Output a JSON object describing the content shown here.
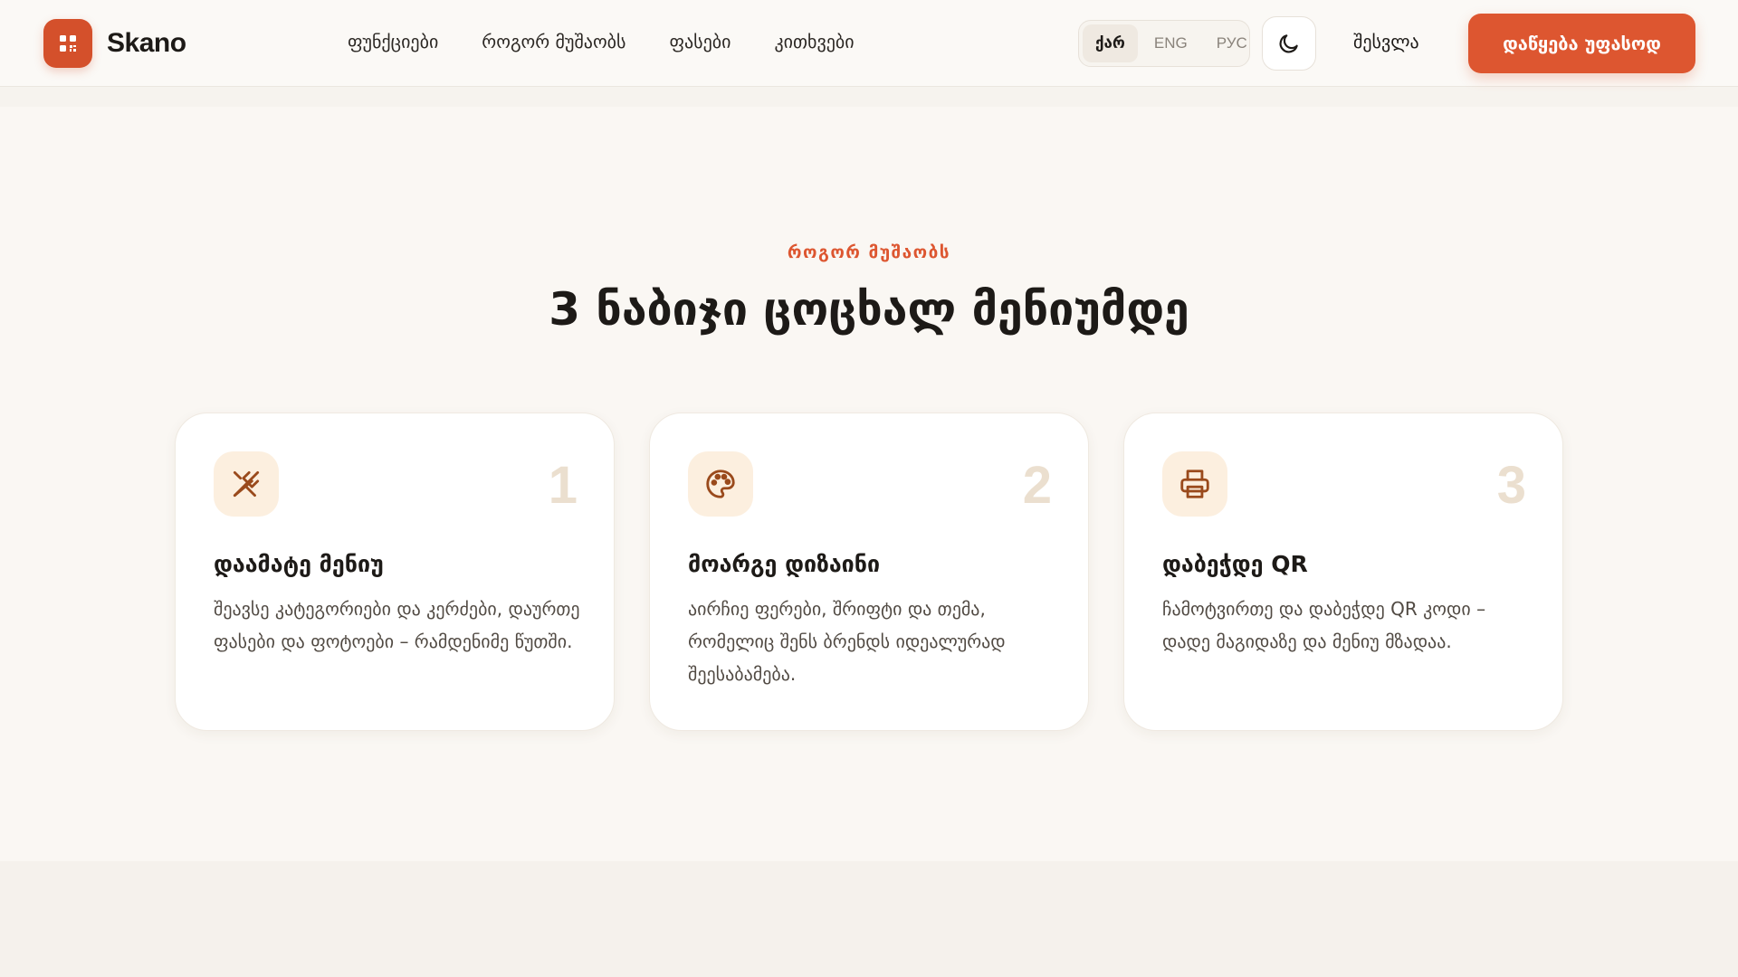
{
  "header": {
    "brand": "Skano",
    "nav": [
      "ფუნქციები",
      "როგორ მუშაობს",
      "ფასები",
      "კითხვები"
    ],
    "languages": [
      "ქარ",
      "ENG",
      "РУС"
    ],
    "active_language": "ქარ",
    "theme_icon": "moon-icon",
    "login_label": "შესვლა",
    "cta_label": "დაწყება უფასოდ"
  },
  "section": {
    "eyebrow": "როგორ მუშაობს",
    "title": "3 ნაბიჯი ცოცხალ მენიუმდე",
    "steps": [
      {
        "number": "1",
        "icon": "utensils-icon",
        "title": "დაამატე მენიუ",
        "description": "შეავსე კატეგორიები და კერძები, დაურთე ფასები და ფოტოები – რამდენიმე წუთში."
      },
      {
        "number": "2",
        "icon": "palette-icon",
        "title": "მოარგე დიზაინი",
        "description": "აირჩიე ფერები, შრიფტი და თემა, რომელიც შენს ბრენდს იდეალურად შეესაბამება."
      },
      {
        "number": "3",
        "icon": "printer-icon",
        "title": "დაბეჭდე QR",
        "description": "ჩამოტვირთე და დაბეჭდე QR კოდი – დადე მაგიდაზე და მენიუ მზადაა."
      }
    ]
  },
  "colors": {
    "accent": "#dd5630",
    "icon_bg": "#fcefdf",
    "icon_stroke": "#9a4a1c",
    "step_number": "#ebdfcf"
  }
}
